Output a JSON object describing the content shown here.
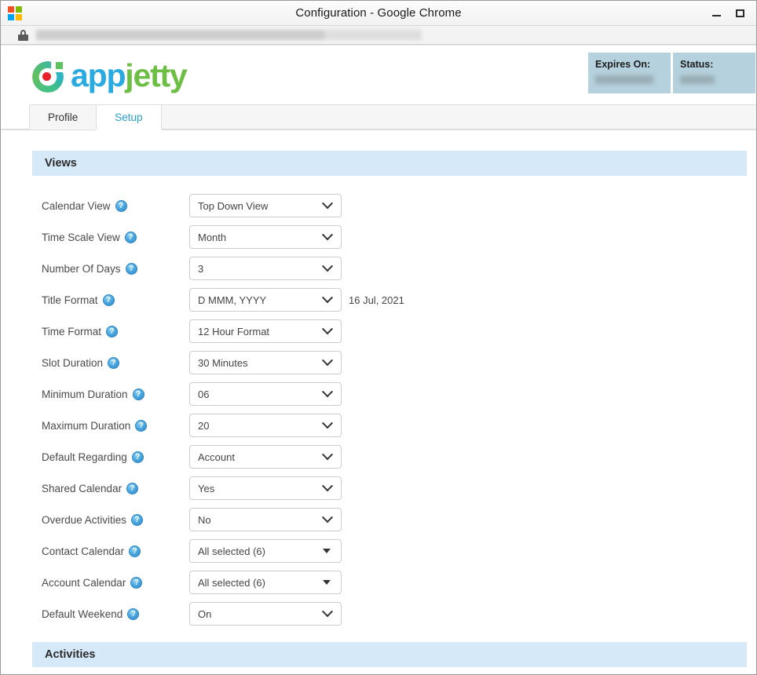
{
  "window": {
    "title": "Configuration - Google Chrome",
    "os_logo_icon": "windows-logo-icon",
    "minimize_label": "Minimize",
    "maximize_label": "Maximize"
  },
  "addressbar": {
    "lock_icon": "lock-icon",
    "url": ""
  },
  "brand": {
    "logo_text_part1": "app",
    "logo_text_part2": "jetty",
    "logo_color_app": "#29abe2",
    "logo_color_jetty": "#6dbe45",
    "logo_dot_color": "#e8202a"
  },
  "license": {
    "boxes": [
      {
        "label": "Expires On:",
        "value": ""
      },
      {
        "label": "Status:",
        "value": ""
      }
    ],
    "background_color": "#b5d1dd"
  },
  "tabs": [
    {
      "label": "Profile",
      "active": false
    },
    {
      "label": "Setup",
      "active": true
    }
  ],
  "sections": [
    {
      "title": "Views",
      "header_color": "#d6e9f8",
      "rows": [
        {
          "label": "Calendar View",
          "help": "?",
          "value": "Top Down View",
          "arrow": "chevron",
          "preview": ""
        },
        {
          "label": "Time Scale View",
          "help": "?",
          "value": "Month",
          "arrow": "chevron",
          "preview": ""
        },
        {
          "label": "Number Of Days",
          "help": "?",
          "value": "3",
          "arrow": "chevron",
          "preview": ""
        },
        {
          "label": "Title Format",
          "help": "?",
          "value": "D MMM, YYYY",
          "arrow": "chevron",
          "preview": "16 Jul, 2021"
        },
        {
          "label": "Time Format",
          "help": "?",
          "value": "12 Hour Format",
          "arrow": "chevron",
          "preview": ""
        },
        {
          "label": "Slot Duration",
          "help": "?",
          "value": "30 Minutes",
          "arrow": "chevron",
          "preview": ""
        },
        {
          "label": "Minimum Duration",
          "help": "?",
          "value": "06",
          "arrow": "chevron",
          "preview": ""
        },
        {
          "label": "Maximum Duration",
          "help": "?",
          "value": "20",
          "arrow": "chevron",
          "preview": ""
        },
        {
          "label": "Default Regarding",
          "help": "?",
          "value": "Account",
          "arrow": "chevron",
          "preview": ""
        },
        {
          "label": "Shared Calendar",
          "help": "?",
          "value": "Yes",
          "arrow": "chevron",
          "preview": ""
        },
        {
          "label": "Overdue Activities",
          "help": "?",
          "value": "No",
          "arrow": "chevron",
          "preview": ""
        },
        {
          "label": "Contact Calendar",
          "help": "?",
          "value": "All selected (6)",
          "arrow": "caret",
          "preview": ""
        },
        {
          "label": "Account Calendar",
          "help": "?",
          "value": "All selected (6)",
          "arrow": "caret",
          "preview": ""
        },
        {
          "label": "Default Weekend",
          "help": "?",
          "value": "On",
          "arrow": "chevron",
          "preview": ""
        }
      ]
    },
    {
      "title": "Activities",
      "header_color": "#d6e9f8",
      "rows": []
    }
  ]
}
